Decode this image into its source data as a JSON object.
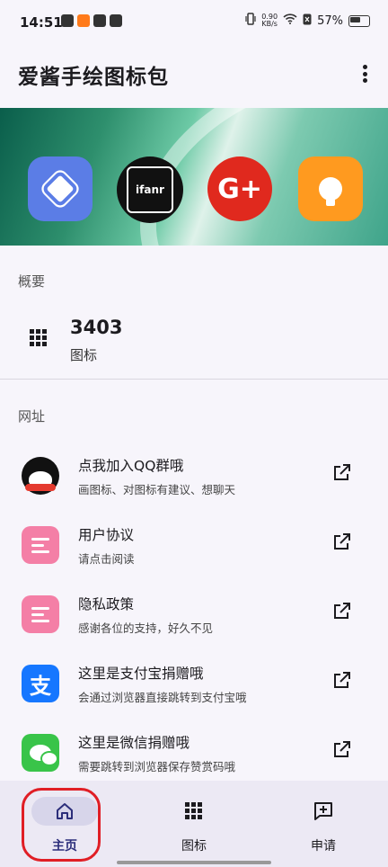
{
  "status_bar": {
    "time": "14:51",
    "net_speed_value": "0.90",
    "net_speed_unit": "KB/s",
    "battery": "57%"
  },
  "app_bar": {
    "title": "爱酱手绘图标包",
    "menu_icon": "more-vert-icon"
  },
  "banner": {
    "icons": [
      "box-icon",
      "ifanr",
      "G+",
      "lightbulb-icon"
    ],
    "ifanr_label": "ifanr",
    "gplus_label": "G+"
  },
  "overview": {
    "section_title": "概要",
    "icon_count": "3403",
    "icon_count_label": "图标"
  },
  "links": {
    "section_title": "网址",
    "items": [
      {
        "title": "点我加入QQ群哦",
        "subtitle": "画图标、对图标有建议、想聊天",
        "icon": "qq-penguin-icon"
      },
      {
        "title": "用户协议",
        "subtitle": "请点击阅读",
        "icon": "document-icon"
      },
      {
        "title": "隐私政策",
        "subtitle": "感谢各位的支持，好久不见",
        "icon": "document-icon"
      },
      {
        "title": "这里是支付宝捐赠哦",
        "subtitle": "会通过浏览器直接跳转到支付宝哦",
        "icon": "alipay-icon"
      },
      {
        "title": "这里是微信捐赠哦",
        "subtitle": "需要跳转到浏览器保存赞赏码哦",
        "icon": "wechat-icon"
      }
    ]
  },
  "bottom_nav": {
    "items": [
      {
        "label": "主页",
        "icon": "home-icon",
        "active": true
      },
      {
        "label": "图标",
        "icon": "grid-icon",
        "active": false
      },
      {
        "label": "申请",
        "icon": "add-comment-icon",
        "active": false
      }
    ]
  },
  "colors": {
    "accent": "#2b2d7a",
    "highlight_ring": "#e01e25",
    "nav_background": "#ece9f4"
  }
}
